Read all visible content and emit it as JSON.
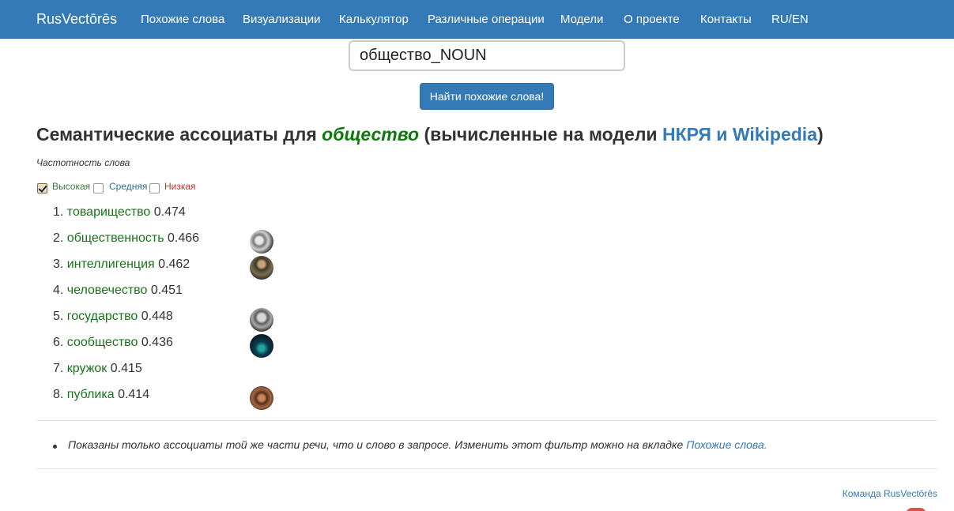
{
  "nav": {
    "brand": "RusVectōrēs",
    "items": [
      "Похожие слова",
      "Визуализации",
      "Калькулятор",
      "Различные операции",
      "Модели",
      "О проекте",
      "Контакты",
      "RU/EN"
    ]
  },
  "search": {
    "value": "общество_NOUN",
    "button_label": "Найти похожие слова!"
  },
  "heading": {
    "prefix": "Семантические ассоциаты для ",
    "word": "общество",
    "middle": " (вычисленные на модели ",
    "model1": "НКРЯ",
    "and": " и ",
    "model2": "Wikipedia",
    "suffix": ")"
  },
  "frequency": {
    "label": "Частотность слова",
    "options": [
      {
        "label": "Высокая",
        "checked": true,
        "color": "#3c763d"
      },
      {
        "label": "Средняя",
        "checked": false,
        "color": "#31708f"
      },
      {
        "label": "Низкая",
        "checked": false,
        "color": "#c9302c"
      }
    ]
  },
  "results": [
    {
      "num": "1.",
      "word": "товарищество",
      "score": "0.474",
      "image": false
    },
    {
      "num": "2.",
      "word": "общественность",
      "score": "0.466",
      "image": true
    },
    {
      "num": "3.",
      "word": "интеллигенция",
      "score": "0.462",
      "image": true
    },
    {
      "num": "4.",
      "word": "человечество",
      "score": "0.451",
      "image": false
    },
    {
      "num": "5.",
      "word": "государство",
      "score": "0.448",
      "image": true
    },
    {
      "num": "6.",
      "word": "сообщество",
      "score": "0.436",
      "image": true
    },
    {
      "num": "7.",
      "word": "кружок",
      "score": "0.415",
      "image": false
    },
    {
      "num": "8.",
      "word": "публика",
      "score": "0.414",
      "image": true
    }
  ],
  "note": {
    "text": "Показаны только ассоциаты той же части речи, что и слово в запросе. Изменить этот фильтр можно на вкладке ",
    "link": "Похожие слова",
    "end": "."
  },
  "footer": {
    "team": "Команда RusVectōrēs"
  },
  "colors": {
    "navbar": "#337ab7",
    "accent_word": "#0a7a0a",
    "result_word": "#197319",
    "link": "#337ab7"
  }
}
